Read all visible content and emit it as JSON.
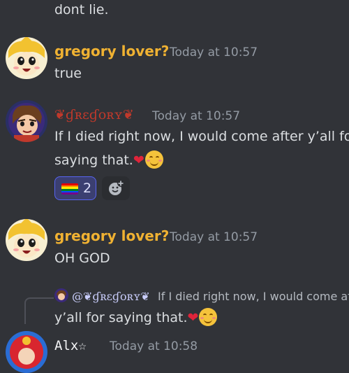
{
  "messages": {
    "prev_tail": "dont lie.",
    "m1": {
      "author": "gregory lover?",
      "author_color": "#f0b232",
      "time": "Today at 10:57",
      "text": "true"
    },
    "m2": {
      "author": "❦ɠʀɛɠօʀʏ❦",
      "author_color": "#c0392b",
      "time": "Today at 10:57",
      "line1": "If I died right now, I would come after y’all for",
      "line2": "saying that.",
      "reactions": [
        {
          "emoji": "rainbow-flag",
          "count": "2"
        }
      ]
    },
    "m3": {
      "author": "gregory lover?",
      "author_color": "#f0b232",
      "time": "Today at 10:57",
      "text": "OH GOD"
    },
    "m4": {
      "reply_author": "@❦ɠʀɛɠօʀʏ❦",
      "reply_text": "If I died right now, I would come afte",
      "line1": "y’all for saying that.",
      "author": "Alx☆",
      "time": "Today at 10:58"
    }
  },
  "colors": {
    "background": "#313338",
    "mention": "#c9cdfb",
    "heart": "#e0243a",
    "reaction_border": "#5865f2"
  }
}
